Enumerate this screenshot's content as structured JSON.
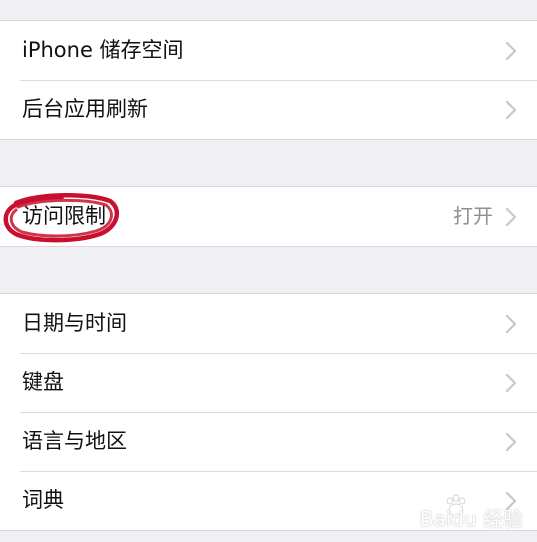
{
  "groups": [
    {
      "items": [
        {
          "label": "iPhone 储存空间"
        },
        {
          "label": "后台应用刷新"
        }
      ]
    },
    {
      "items": [
        {
          "label": "访问限制",
          "value": "打开"
        }
      ]
    },
    {
      "items": [
        {
          "label": "日期与时间"
        },
        {
          "label": "键盘"
        },
        {
          "label": "语言与地区"
        },
        {
          "label": "词典"
        }
      ]
    }
  ],
  "icons": {
    "disclosure": "chevron-right-icon",
    "highlight": "red-circle-annotation",
    "watermark": "baidu-paw-logo"
  },
  "colors": {
    "background": "#efeff4",
    "cell": "#ffffff",
    "chevron": "#c7c7cc",
    "secondary_text": "#8e8e93",
    "annotation": "#c8102e"
  },
  "watermark": {
    "text": "Baidu 经验"
  }
}
